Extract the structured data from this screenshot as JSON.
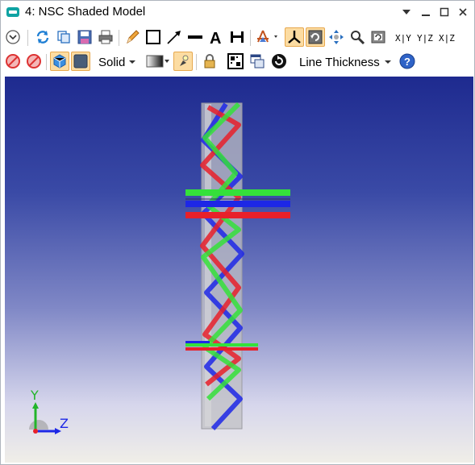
{
  "window": {
    "title": "4: NSC Shaded Model",
    "controls": [
      "pin-dropdown",
      "minimize",
      "maximize",
      "close"
    ]
  },
  "toolbar_row1": {
    "buttons": [
      "settings-dropdown",
      "update",
      "copy",
      "save",
      "print",
      "pencil",
      "rectangle",
      "arrow",
      "line",
      "text",
      "dimension",
      "layout-options",
      "axis-orientation",
      "rotate-view",
      "pan",
      "zoom",
      "reset-view"
    ],
    "axis_views": [
      "X|Y",
      "Y|Z",
      "X|Z"
    ]
  },
  "toolbar_row2": {
    "render_mode": "Solid",
    "line_thickness_label": "Line Thickness",
    "buttons": [
      "no-entry-1",
      "no-entry-2",
      "cube-view",
      "flat-view",
      "color-gradient",
      "light",
      "lock",
      "checker",
      "window-copy",
      "refresh",
      "help"
    ]
  },
  "viewport": {
    "axis_labels": {
      "y": "Y",
      "z": "Z"
    },
    "colors": {
      "red": "#e8202a",
      "green": "#35e03a",
      "blue": "#1d27e6",
      "glass": "#c0c0c4"
    }
  }
}
